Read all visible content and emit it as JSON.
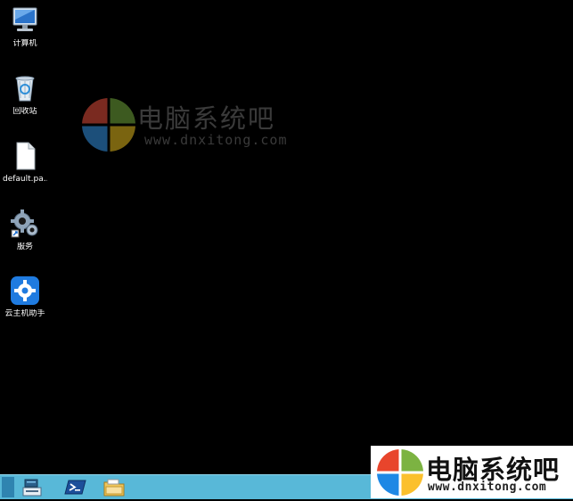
{
  "desktop": {
    "icons": [
      {
        "label": "计算机",
        "icon": "computer-icon"
      },
      {
        "label": "回收站",
        "icon": "recycle-bin-icon"
      },
      {
        "label": "default.pa...",
        "icon": "file-icon"
      },
      {
        "label": "服务",
        "icon": "services-gear-icon"
      },
      {
        "label": "云主机助手",
        "icon": "cloud-host-assistant-icon"
      }
    ]
  },
  "watermark": {
    "title": "电脑系统吧",
    "url": "www.dnxitong.com"
  },
  "taskbar": {
    "buttons": [
      {
        "icon": "server-manager-icon"
      },
      {
        "icon": "powershell-icon"
      },
      {
        "icon": "file-explorer-icon"
      }
    ],
    "color": "#58b8d8"
  },
  "brand_overlay": {
    "title": "电脑系统吧",
    "url": "www.dnxitong.com"
  },
  "colors": {
    "desktop_bg": "#000000",
    "logo_red": "#e8452c",
    "logo_green": "#7cb342",
    "logo_blue": "#1e88e5",
    "logo_yellow": "#fbc02d"
  }
}
